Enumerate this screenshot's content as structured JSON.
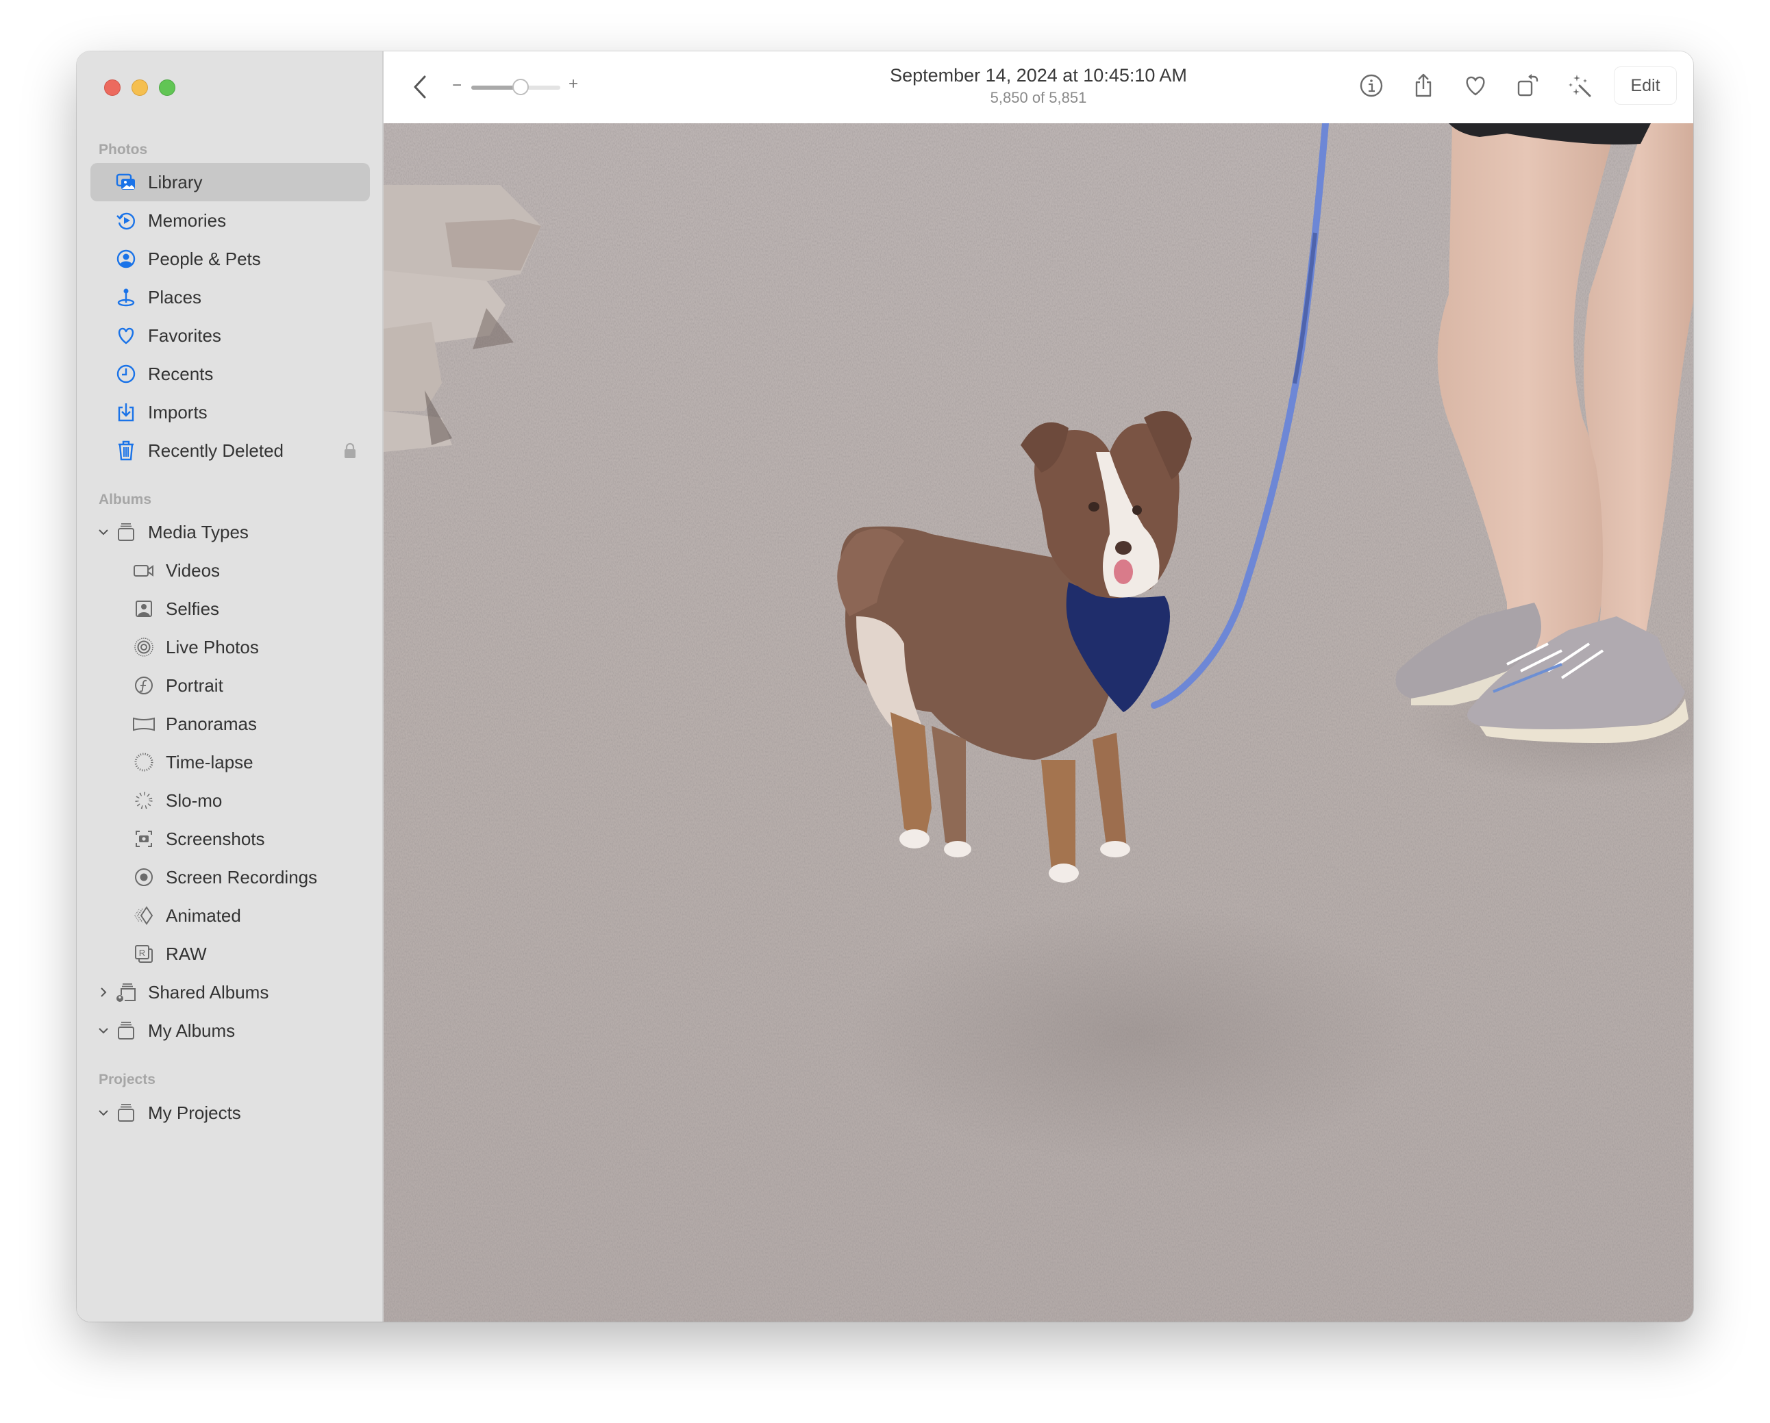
{
  "window": {
    "traffic_lights": [
      "close",
      "minimize",
      "zoom"
    ]
  },
  "sidebar": {
    "sections": {
      "photos": "Photos",
      "albums": "Albums",
      "projects": "Projects"
    },
    "photos_items": [
      {
        "label": "Library",
        "icon": "library-icon",
        "selected": true
      },
      {
        "label": "Memories",
        "icon": "memories-icon"
      },
      {
        "label": "People & Pets",
        "icon": "people-icon"
      },
      {
        "label": "Places",
        "icon": "places-pin-icon"
      },
      {
        "label": "Favorites",
        "icon": "heart-icon"
      },
      {
        "label": "Recents",
        "icon": "clock-icon"
      },
      {
        "label": "Imports",
        "icon": "import-icon"
      },
      {
        "label": "Recently Deleted",
        "icon": "trash-icon",
        "locked": true
      }
    ],
    "albums": {
      "media_types": {
        "label": "Media Types",
        "expanded": true
      },
      "media_items": [
        {
          "label": "Videos",
          "icon": "video-camera-icon"
        },
        {
          "label": "Selfies",
          "icon": "selfie-icon"
        },
        {
          "label": "Live Photos",
          "icon": "live-photo-icon"
        },
        {
          "label": "Portrait",
          "icon": "portrait-f-icon"
        },
        {
          "label": "Panoramas",
          "icon": "panorama-icon"
        },
        {
          "label": "Time-lapse",
          "icon": "timelapse-icon"
        },
        {
          "label": "Slo-mo",
          "icon": "slomo-icon"
        },
        {
          "label": "Screenshots",
          "icon": "screenshot-icon"
        },
        {
          "label": "Screen Recordings",
          "icon": "screen-recording-icon"
        },
        {
          "label": "Animated",
          "icon": "animated-icon"
        },
        {
          "label": "RAW",
          "icon": "raw-icon"
        }
      ],
      "shared_albums": {
        "label": "Shared Albums",
        "expanded": false
      },
      "my_albums": {
        "label": "My Albums",
        "expanded": true
      }
    },
    "projects": {
      "my_projects": {
        "label": "My Projects",
        "expanded": true
      }
    }
  },
  "toolbar": {
    "title": "September 14, 2024 at 10:45:10 AM",
    "subtitle": "5,850 of 5,851",
    "zoom_minus": "−",
    "zoom_plus": "+",
    "zoom_level": 0.55,
    "edit_label": "Edit",
    "icons": [
      "info-icon",
      "share-icon",
      "favorite-heart-icon",
      "rotate-icon",
      "auto-enhance-wand-icon"
    ]
  },
  "photo": {
    "alt": "Small brown and white dog in a navy harness on a blue leash, standing on a dusty ground next to a person's legs in sneakers"
  },
  "colors": {
    "accent": "#1a73e8",
    "sidebar_bg": "#e1e1e1",
    "selected_row": "#c8c8c8",
    "icon_gray": "#6b6b6b"
  }
}
